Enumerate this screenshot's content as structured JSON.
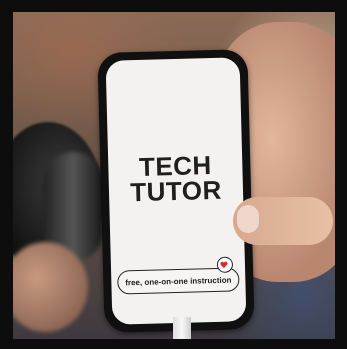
{
  "screen": {
    "headline_line1": "TECH",
    "headline_line2": "TUTOR",
    "tagline": "free, one-on-one instruction",
    "badge_icon": "heart-icon"
  },
  "colors": {
    "screen_bg": "#f3f2f0",
    "text": "#1f1f1f",
    "heart": "#e0252d"
  }
}
